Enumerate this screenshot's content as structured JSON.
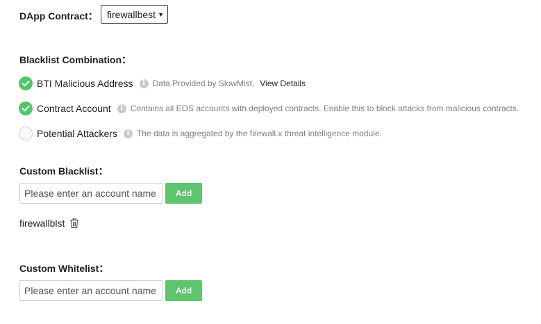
{
  "dapp_contract": {
    "label": "DApp Contract：",
    "selected": "firewallbest"
  },
  "blacklist_combination": {
    "label": "Blacklist Combination：",
    "items": [
      {
        "title": "BTI Malicious Address",
        "checked": true,
        "info_icon": "info-icon",
        "description": "Data Provided by SlowMist,",
        "link": "View Details"
      },
      {
        "title": "Contract Account",
        "checked": true,
        "info_icon": "info-icon",
        "description": "Contains all EOS accounts with deployed contracts. Enable this to block attacks from malicious contracts."
      },
      {
        "title": "Potential Attackers",
        "checked": false,
        "info_icon": "info-icon",
        "description": "The data is aggregated by the firewall.x threat intelligence module."
      }
    ]
  },
  "custom_blacklist": {
    "label": "Custom Blacklist：",
    "placeholder": "Please enter an account name",
    "add_label": "Add",
    "entries": [
      "firewallblst"
    ]
  },
  "custom_whitelist": {
    "label": "Custom Whitelist：",
    "placeholder": "Please enter an account name",
    "add_label": "Add"
  },
  "colors": {
    "accent": "#5cc56d",
    "check_on": "#52c76a",
    "muted_text": "#7d7d7d"
  }
}
